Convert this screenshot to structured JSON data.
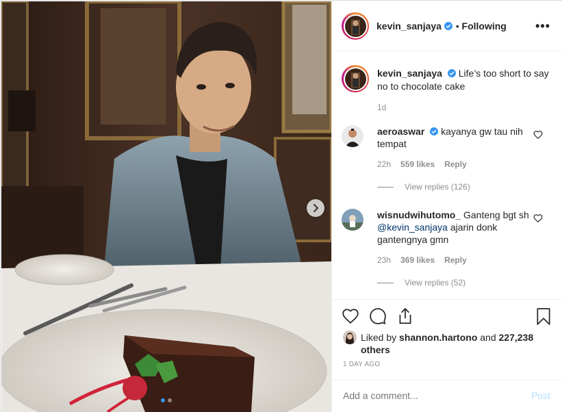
{
  "post": {
    "author": "kevin_sanjaya",
    "follow_separator": "•",
    "follow_state": "Following",
    "more_icon": "more-options-icon",
    "more_glyph": "•••"
  },
  "caption": {
    "username": "kevin_sanjaya",
    "text": "Life’s too short to say no to chocolate cake",
    "time": "1d"
  },
  "comments": [
    {
      "username": "aeroaswar",
      "verified": true,
      "text": "kayanya gw tau nih tempat",
      "time": "22h",
      "likes": "559 likes",
      "reply_label": "Reply",
      "view_replies": "View replies (126)"
    },
    {
      "username": "wisnudwihutomo_",
      "verified": false,
      "text_before": "Ganteng bgt sh",
      "mention": "@kevin_sanjaya",
      "text_after": "ajarin donk gantengnya gmn",
      "time": "23h",
      "likes": "369 likes",
      "reply_label": "Reply",
      "view_replies": "View replies (52)"
    }
  ],
  "likes": {
    "prefix": "Liked by",
    "liker": "shannon.hartono",
    "conj": "and",
    "others": "227,238 others"
  },
  "timestamp": "1 DAY AGO",
  "composer": {
    "placeholder": "Add a comment...",
    "post_label": "Post"
  },
  "carousel": {
    "slide_count": 2,
    "active_index": 0
  },
  "colors": {
    "verified_blue": "#3897f0",
    "post_disabled": "#b2dffc",
    "muted": "#8e8e8e",
    "mention": "#003569"
  },
  "icons": [
    "heart-icon",
    "comment-icon",
    "share-icon",
    "bookmark-icon",
    "chevron-right-icon",
    "verified-badge-icon"
  ]
}
